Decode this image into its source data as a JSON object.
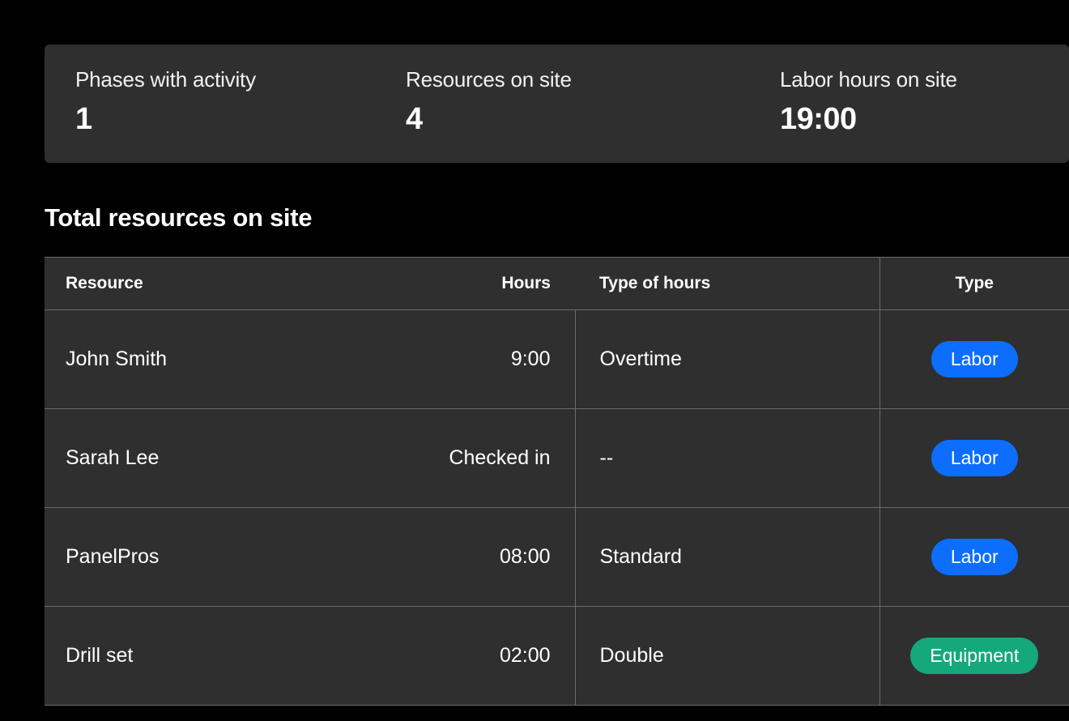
{
  "summary": {
    "phases": {
      "label": "Phases with activity",
      "value": "1"
    },
    "resources": {
      "label": "Resources on site",
      "value": "4"
    },
    "labor_hours": {
      "label": "Labor hours on site",
      "value": "19:00"
    }
  },
  "section_title": "Total resources on site",
  "table": {
    "headers": {
      "resource": "Resource",
      "hours": "Hours",
      "type_of_hours": "Type of hours",
      "type": "Type"
    },
    "rows": [
      {
        "resource": "John Smith",
        "hours": "9:00",
        "type_of_hours": "Overtime",
        "type": "Labor",
        "type_kind": "labor"
      },
      {
        "resource": "Sarah Lee",
        "hours": "Checked in",
        "type_of_hours": "--",
        "type": "Labor",
        "type_kind": "labor"
      },
      {
        "resource": "PanelPros",
        "hours": "08:00",
        "type_of_hours": "Standard",
        "type": "Labor",
        "type_kind": "labor"
      },
      {
        "resource": "Drill set",
        "hours": "02:00",
        "type_of_hours": "Double",
        "type": "Equipment",
        "type_kind": "equipment"
      }
    ]
  },
  "colors": {
    "labor_badge": "#0d6efd",
    "equipment_badge": "#15a87a",
    "panel_bg": "#2f2f2f",
    "border": "#6b6b6b"
  }
}
